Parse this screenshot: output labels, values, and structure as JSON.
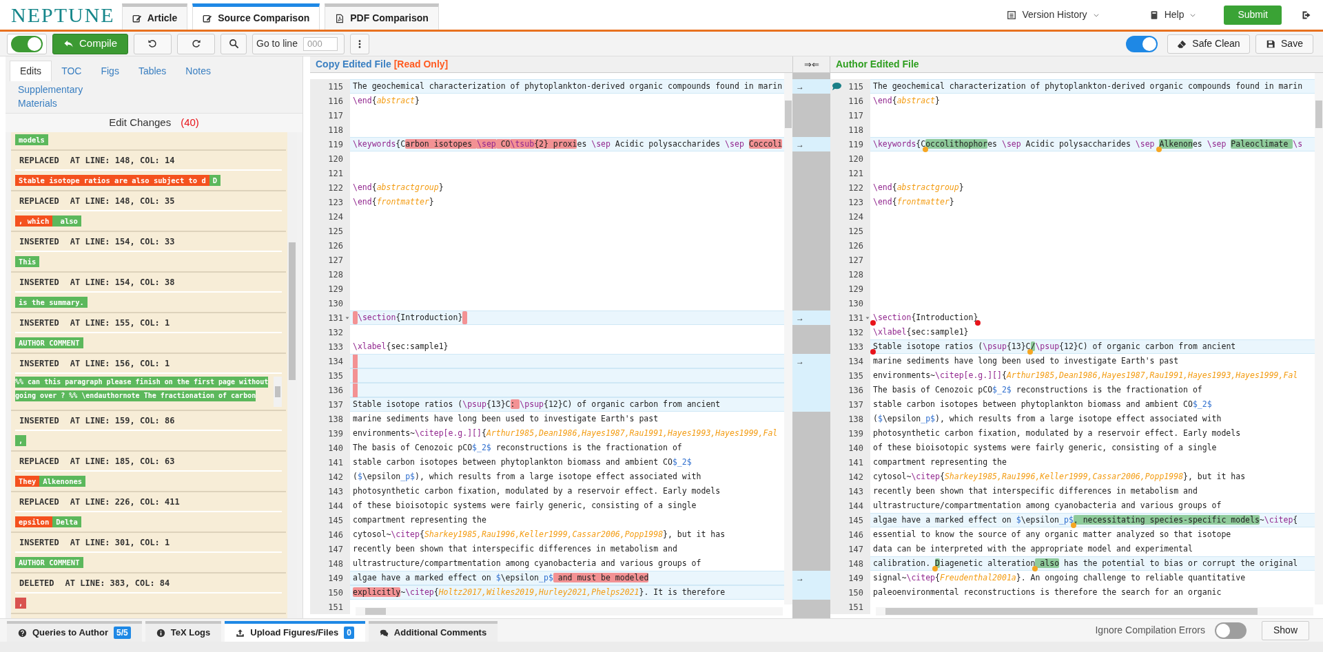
{
  "app": {
    "logo": "NEPTUNE"
  },
  "top_tabs": [
    {
      "label": "Article",
      "kind": "edit",
      "selected": false
    },
    {
      "label": "Source Comparison",
      "kind": "edit",
      "selected": true
    },
    {
      "label": "PDF Comparison",
      "kind": "pdf",
      "selected": false
    }
  ],
  "top_menu": [
    {
      "label": "Version History",
      "kind": "history"
    },
    {
      "label": "Help",
      "kind": "help"
    }
  ],
  "submit": "Submit",
  "toolbar": {
    "compile_toggle_on": true,
    "compile": "Compile",
    "goto_label": "Go to line",
    "goto_placeholder": "000",
    "safe_clean_toggle_on": true,
    "safe_clean": "Safe Clean",
    "save": "Save"
  },
  "side_tabs": [
    {
      "label": "Edits",
      "selected": true
    },
    {
      "label": "TOC",
      "selected": false
    },
    {
      "label": "Figs",
      "selected": false
    },
    {
      "label": "Tables",
      "selected": false
    },
    {
      "label": "Notes",
      "selected": false
    },
    {
      "label": "Supplementary Materials",
      "selected": false
    }
  ],
  "edit_changes": {
    "title": "Edit Changes",
    "count": "(40)",
    "items": [
      {
        "chips": [
          {
            "kind": "new",
            "text": "models"
          }
        ]
      },
      {
        "type": "REPLACED",
        "position": "AT LINE: 148, COL: 14",
        "chips": [
          {
            "kind": "old",
            "text": "Stable isotope ratios are also subject to d"
          },
          {
            "kind": "new",
            "text": "D"
          }
        ]
      },
      {
        "type": "REPLACED",
        "position": "AT LINE: 148, COL: 35",
        "chips": [
          {
            "kind": "old",
            "text": ", which"
          },
          {
            "kind": "new",
            "text": " also"
          }
        ]
      },
      {
        "type": "INSERTED",
        "position": "AT LINE: 154, COL: 33",
        "chips": [
          {
            "kind": "new",
            "text": "This"
          }
        ]
      },
      {
        "type": "INSERTED",
        "position": "AT LINE: 154, COL: 38",
        "chips": [
          {
            "kind": "new",
            "text": "is the summary."
          }
        ]
      },
      {
        "type": "INSERTED",
        "position": "AT LINE: 155, COL: 1",
        "chips": [
          {
            "kind": "new",
            "text": "AUTHOR COMMENT"
          }
        ]
      },
      {
        "type": "INSERTED",
        "position": "AT LINE: 156, COL: 1",
        "lines": [
          "%% can this paragraph please finish on the first page without",
          "going over ? %% \\endauthornote The fractionation of carbon"
        ]
      },
      {
        "type": "INSERTED",
        "position": "AT LINE: 159, COL: 86",
        "chips": [
          {
            "kind": "new",
            "text": ","
          }
        ]
      },
      {
        "type": "REPLACED",
        "position": "AT LINE: 185, COL: 63",
        "chips": [
          {
            "kind": "old",
            "text": "They"
          },
          {
            "kind": "new",
            "text": "Alkenones"
          }
        ]
      },
      {
        "type": "REPLACED",
        "position": "AT LINE: 226, COL: 411",
        "chips": [
          {
            "kind": "old",
            "text": "epsilon"
          },
          {
            "kind": "new",
            "text": "Delta"
          }
        ]
      },
      {
        "type": "INSERTED",
        "position": "AT LINE: 301, COL: 1",
        "chips": [
          {
            "kind": "new",
            "text": "AUTHOR COMMENT"
          }
        ]
      },
      {
        "type": "DELETED",
        "position": "AT LINE: 383, COL: 84",
        "chips": [
          {
            "kind": "deleted",
            "text": ","
          }
        ]
      }
    ]
  },
  "sync_button": "⇒⇐",
  "copy_pane": {
    "title": "Copy Edited File",
    "note": "[Read Only]",
    "lines": [
      {
        "n": "115",
        "changed": true,
        "merge": "→",
        "segments": [
          {
            "text": "The geochemical characterization of phytoplankton-derived organic compounds found in marin",
            "kind": "p"
          }
        ]
      },
      {
        "n": "116",
        "changed": false,
        "segments": [
          {
            "text": "\\end",
            "kind": "c"
          },
          {
            "text": "{",
            "kind": "p"
          },
          {
            "text": "abstract",
            "kind": "a"
          },
          {
            "text": "}",
            "kind": "p"
          }
        ]
      },
      {
        "n": "117",
        "changed": false
      },
      {
        "n": "118",
        "changed": false
      },
      {
        "n": "119",
        "changed": true,
        "merge": "→",
        "segments": [
          {
            "text": "\\keywords",
            "kind": "c"
          },
          {
            "text": "{C",
            "kind": "p"
          },
          {
            "text": "arbon isotopes ",
            "kind": "h"
          },
          {
            "text": "\\sep",
            "kind": "hc"
          },
          {
            "text": " CO",
            "kind": "h"
          },
          {
            "text": "\\tsub",
            "kind": "hc"
          },
          {
            "text": "{2} proxi",
            "kind": "h"
          },
          {
            "text": "es ",
            "kind": "p"
          },
          {
            "text": "\\sep",
            "kind": "c"
          },
          {
            "text": " Acidic polysaccharides ",
            "kind": "p"
          },
          {
            "text": "\\sep ",
            "kind": "c"
          },
          {
            "text": "Coccoli",
            "kind": "h"
          }
        ]
      },
      {
        "n": "120",
        "changed": false
      },
      {
        "n": "121",
        "changed": false
      },
      {
        "n": "122",
        "changed": false,
        "segments": [
          {
            "text": "\\end",
            "kind": "c"
          },
          {
            "text": "{",
            "kind": "p"
          },
          {
            "text": "abstractgroup",
            "kind": "a"
          },
          {
            "text": "}",
            "kind": "p"
          }
        ]
      },
      {
        "n": "123",
        "changed": false,
        "segments": [
          {
            "text": "\\end",
            "kind": "c"
          },
          {
            "text": "{",
            "kind": "p"
          },
          {
            "text": "frontmatter",
            "kind": "a"
          },
          {
            "text": "}",
            "kind": "p"
          }
        ]
      },
      {
        "n": "124",
        "changed": false
      },
      {
        "n": "125",
        "changed": false
      },
      {
        "n": "126",
        "changed": false
      },
      {
        "n": "127",
        "changed": false
      },
      {
        "n": "128",
        "changed": false
      },
      {
        "n": "129",
        "changed": false
      },
      {
        "n": "130",
        "changed": false
      },
      {
        "n": "131",
        "changed": true,
        "fold": true,
        "merge": "→",
        "segments": [
          {
            "kind": "gap"
          },
          {
            "text": "\\section",
            "kind": "c"
          },
          {
            "text": "{Introduction}",
            "kind": "p"
          },
          {
            "kind": "gap"
          }
        ]
      },
      {
        "n": "132",
        "changed": false
      },
      {
        "n": "133",
        "changed": false,
        "segments": [
          {
            "text": "\\xlabel",
            "kind": "c"
          },
          {
            "text": "{sec:sample1}",
            "kind": "p"
          }
        ]
      },
      {
        "n": "134",
        "changed": true,
        "merge": "→",
        "segments": [
          {
            "kind": "gap"
          }
        ]
      },
      {
        "n": "135",
        "changed": true,
        "segments": [
          {
            "kind": "gap"
          }
        ]
      },
      {
        "n": "136",
        "changed": true,
        "segments": [
          {
            "kind": "gap"
          }
        ]
      },
      {
        "n": "137",
        "changed": true,
        "segments": [
          {
            "text": "Stable isotope ratios (",
            "kind": "p"
          },
          {
            "text": "\\psup",
            "kind": "c"
          },
          {
            "text": "{13}C",
            "kind": "p"
          },
          {
            "text": ": ",
            "kind": "h"
          },
          {
            "text": "\\psup",
            "kind": "c"
          },
          {
            "text": "{12}C) of organic carbon from ancient",
            "kind": "p"
          }
        ]
      },
      {
        "n": "138",
        "changed": false,
        "segments": [
          {
            "text": "marine sediments have long been used to investigate Earth's past",
            "kind": "p"
          }
        ]
      },
      {
        "n": "139",
        "changed": false,
        "segments": [
          {
            "text": "environments~",
            "kind": "p"
          },
          {
            "text": "\\citep[e.g.][]",
            "kind": "c"
          },
          {
            "text": "{",
            "kind": "p"
          },
          {
            "text": "Arthur1985,Dean1986,Hayes1987,Rau1991,Hayes1993,Hayes1999,Fal",
            "kind": "a"
          }
        ]
      },
      {
        "n": "140",
        "changed": false,
        "segments": [
          {
            "text": "The basis of Cenozoic pCO",
            "kind": "p"
          },
          {
            "text": "$_2$",
            "kind": "m"
          },
          {
            "text": " reconstructions is the fractionation of",
            "kind": "p"
          }
        ]
      },
      {
        "n": "141",
        "changed": false,
        "segments": [
          {
            "text": "stable carbon isotopes between phytoplankton biomass and ambient CO",
            "kind": "p"
          },
          {
            "text": "$_2$",
            "kind": "m"
          }
        ]
      },
      {
        "n": "142",
        "changed": false,
        "segments": [
          {
            "text": "(",
            "kind": "p"
          },
          {
            "text": "$",
            "kind": "m"
          },
          {
            "text": "\\epsilon",
            "kind": "p"
          },
          {
            "text": "_p$",
            "kind": "m"
          },
          {
            "text": "), which results from a large isotope effect associated with",
            "kind": "p"
          }
        ]
      },
      {
        "n": "143",
        "changed": false,
        "segments": [
          {
            "text": "photosynthetic carbon fixation, modulated by a reservoir effect. Early models",
            "kind": "p"
          }
        ]
      },
      {
        "n": "144",
        "changed": false,
        "segments": [
          {
            "text": "of these bioisotopic systems were fairly generic, consisting of a single",
            "kind": "p"
          }
        ]
      },
      {
        "n": "145",
        "changed": false,
        "segments": [
          {
            "text": "compartment representing the",
            "kind": "p"
          }
        ]
      },
      {
        "n": "146",
        "changed": false,
        "segments": [
          {
            "text": "cytosol~",
            "kind": "p"
          },
          {
            "text": "\\citep",
            "kind": "c"
          },
          {
            "text": "{",
            "kind": "p"
          },
          {
            "text": "Sharkey1985,Rau1996,Keller1999,Cassar2006,Popp1998",
            "kind": "a"
          },
          {
            "text": "}, but it has",
            "kind": "p"
          }
        ]
      },
      {
        "n": "147",
        "changed": false,
        "segments": [
          {
            "text": "recently been shown that interspecific differences in metabolism and",
            "kind": "p"
          }
        ]
      },
      {
        "n": "148",
        "changed": false,
        "segments": [
          {
            "text": "ultrastructure/compartmentation among cyanobacteria and various groups of",
            "kind": "p"
          }
        ]
      },
      {
        "n": "149",
        "changed": true,
        "merge": "→",
        "segments": [
          {
            "text": "algae have a marked effect on ",
            "kind": "p"
          },
          {
            "text": "$",
            "kind": "m"
          },
          {
            "text": "\\epsilon",
            "kind": "p"
          },
          {
            "text": "_p$",
            "kind": "m"
          },
          {
            "text": " and must be modeled",
            "kind": "h"
          }
        ]
      },
      {
        "n": "150",
        "changed": true,
        "segments": [
          {
            "text": "explicitly",
            "kind": "h"
          },
          {
            "text": "~",
            "kind": "p"
          },
          {
            "text": "\\citep",
            "kind": "c"
          },
          {
            "text": "{",
            "kind": "p"
          },
          {
            "text": "Holtz2017,Wilkes2019,Hurley2021,Phelps2021",
            "kind": "a"
          },
          {
            "text": "}. It is therefore",
            "kind": "p"
          }
        ]
      },
      {
        "n": "151",
        "changed": false
      }
    ]
  },
  "author_pane": {
    "title": "Author Edited File",
    "lines": [
      {
        "n": "115",
        "changed": true,
        "comment": true,
        "segments": [
          {
            "text": "The geochemical characterization of phytoplankton-derived organic compounds found in marin",
            "kind": "p"
          }
        ]
      },
      {
        "n": "116",
        "changed": false,
        "segments": [
          {
            "text": "\\end",
            "kind": "c"
          },
          {
            "text": "{",
            "kind": "p"
          },
          {
            "text": "abstract",
            "kind": "a"
          },
          {
            "text": "}",
            "kind": "p"
          }
        ]
      },
      {
        "n": "117",
        "changed": false
      },
      {
        "n": "118",
        "changed": false
      },
      {
        "n": "119",
        "changed": true,
        "segments": [
          {
            "text": "\\keywords",
            "kind": "c"
          },
          {
            "text": "{C",
            "kind": "p"
          },
          {
            "kind": "dot",
            "color": "#f5a623"
          },
          {
            "text": "occolithophor",
            "kind": "h"
          },
          {
            "text": "es ",
            "kind": "p"
          },
          {
            "text": "\\sep",
            "kind": "c"
          },
          {
            "text": " Acidic polysaccharides ",
            "kind": "p"
          },
          {
            "text": "\\sep ",
            "kind": "c"
          },
          {
            "kind": "dot",
            "color": "#f5a623"
          },
          {
            "text": "Alkenon",
            "kind": "h"
          },
          {
            "text": "es ",
            "kind": "p"
          },
          {
            "text": "\\sep ",
            "kind": "c"
          },
          {
            "text": "Paleoclimate ",
            "kind": "h"
          },
          {
            "text": "\\s",
            "kind": "c"
          }
        ]
      },
      {
        "n": "120",
        "changed": false
      },
      {
        "n": "121",
        "changed": false
      },
      {
        "n": "122",
        "changed": false,
        "segments": [
          {
            "text": "\\end",
            "kind": "c"
          },
          {
            "text": "{",
            "kind": "p"
          },
          {
            "text": "abstractgroup",
            "kind": "a"
          },
          {
            "text": "}",
            "kind": "p"
          }
        ]
      },
      {
        "n": "123",
        "changed": false,
        "segments": [
          {
            "text": "\\end",
            "kind": "c"
          },
          {
            "text": "{",
            "kind": "p"
          },
          {
            "text": "frontmatter",
            "kind": "a"
          },
          {
            "text": "}",
            "kind": "p"
          }
        ]
      },
      {
        "n": "124",
        "changed": false
      },
      {
        "n": "125",
        "changed": false
      },
      {
        "n": "126",
        "changed": false
      },
      {
        "n": "127",
        "changed": false
      },
      {
        "n": "128",
        "changed": false
      },
      {
        "n": "129",
        "changed": false
      },
      {
        "n": "130",
        "changed": false
      },
      {
        "n": "131",
        "changed": false,
        "fold": true,
        "segments": [
          {
            "kind": "dot",
            "color": "#e8141b"
          },
          {
            "text": "\\section",
            "kind": "c"
          },
          {
            "text": "{Introduction}",
            "kind": "p"
          },
          {
            "kind": "dot",
            "color": "#e8141b"
          }
        ]
      },
      {
        "n": "132",
        "changed": false,
        "segments": [
          {
            "text": "\\xlabel",
            "kind": "c"
          },
          {
            "text": "{sec:sample1}",
            "kind": "p"
          }
        ]
      },
      {
        "n": "133",
        "changed": true,
        "segments": [
          {
            "kind": "dot",
            "color": "#e8141b"
          },
          {
            "text": "Stable isotope ratios (",
            "kind": "p"
          },
          {
            "text": "\\psup",
            "kind": "c"
          },
          {
            "text": "{13}C",
            "kind": "p"
          },
          {
            "kind": "dot",
            "color": "#f5a623"
          },
          {
            "text": "/",
            "kind": "h"
          },
          {
            "text": "\\psup",
            "kind": "c"
          },
          {
            "text": "{12}C) of organic carbon from ancient",
            "kind": "p"
          }
        ]
      },
      {
        "n": "134",
        "changed": false,
        "segments": [
          {
            "text": "marine sediments have long been used to investigate Earth's past",
            "kind": "p"
          }
        ]
      },
      {
        "n": "135",
        "changed": false,
        "segments": [
          {
            "text": "environments~",
            "kind": "p"
          },
          {
            "text": "\\citep[e.g.][]",
            "kind": "c"
          },
          {
            "text": "{",
            "kind": "p"
          },
          {
            "text": "Arthur1985,Dean1986,Hayes1987,Rau1991,Hayes1993,Hayes1999,Fal",
            "kind": "a"
          }
        ]
      },
      {
        "n": "136",
        "changed": false,
        "segments": [
          {
            "text": "The basis of Cenozoic pCO",
            "kind": "p"
          },
          {
            "text": "$_2$",
            "kind": "m"
          },
          {
            "text": " reconstructions is the fractionation of",
            "kind": "p"
          }
        ]
      },
      {
        "n": "137",
        "changed": false,
        "segments": [
          {
            "text": "stable carbon isotopes between phytoplankton biomass and ambient CO",
            "kind": "p"
          },
          {
            "text": "$_2$",
            "kind": "m"
          }
        ]
      },
      {
        "n": "138",
        "changed": false,
        "segments": [
          {
            "text": "(",
            "kind": "p"
          },
          {
            "text": "$",
            "kind": "m"
          },
          {
            "text": "\\epsilon",
            "kind": "p"
          },
          {
            "text": "_p$",
            "kind": "m"
          },
          {
            "text": "), which results from a large isotope effect associated with",
            "kind": "p"
          }
        ]
      },
      {
        "n": "139",
        "changed": false,
        "segments": [
          {
            "text": "photosynthetic carbon fixation, modulated by a reservoir effect. Early models",
            "kind": "p"
          }
        ]
      },
      {
        "n": "140",
        "changed": false,
        "segments": [
          {
            "text": "of these bioisotopic systems were fairly generic, consisting of a single",
            "kind": "p"
          }
        ]
      },
      {
        "n": "141",
        "changed": false,
        "segments": [
          {
            "text": "compartment representing the",
            "kind": "p"
          }
        ]
      },
      {
        "n": "142",
        "changed": false,
        "segments": [
          {
            "text": "cytosol~",
            "kind": "p"
          },
          {
            "text": "\\citep",
            "kind": "c"
          },
          {
            "text": "{",
            "kind": "p"
          },
          {
            "text": "Sharkey1985,Rau1996,Keller1999,Cassar2006,Popp1998",
            "kind": "a"
          },
          {
            "text": "}, but it has",
            "kind": "p"
          }
        ]
      },
      {
        "n": "143",
        "changed": false,
        "segments": [
          {
            "text": "recently been shown that interspecific differences in metabolism and",
            "kind": "p"
          }
        ]
      },
      {
        "n": "144",
        "changed": false,
        "segments": [
          {
            "text": "ultrastructure/compartmentation among cyanobacteria and various groups of",
            "kind": "p"
          }
        ]
      },
      {
        "n": "145",
        "changed": true,
        "segments": [
          {
            "text": "algae have a marked effect on ",
            "kind": "p"
          },
          {
            "text": "$",
            "kind": "m"
          },
          {
            "text": "\\epsilon",
            "kind": "p"
          },
          {
            "text": "_p$",
            "kind": "m"
          },
          {
            "kind": "dot",
            "color": "#f5a623"
          },
          {
            "text": ", necessitating species-specific models",
            "kind": "h"
          },
          {
            "text": "~",
            "kind": "p"
          },
          {
            "text": "\\citep",
            "kind": "c"
          },
          {
            "text": "{",
            "kind": "p"
          }
        ]
      },
      {
        "n": "146",
        "changed": false,
        "segments": [
          {
            "text": "essential to know the source of any organic matter analyzed so that isotope",
            "kind": "p"
          }
        ]
      },
      {
        "n": "147",
        "changed": false,
        "segments": [
          {
            "text": "data can be interpreted with the appropriate model and experimental",
            "kind": "p"
          }
        ]
      },
      {
        "n": "148",
        "changed": true,
        "segments": [
          {
            "text": "calibration. ",
            "kind": "p"
          },
          {
            "kind": "dot",
            "color": "#f5a623"
          },
          {
            "text": "D",
            "kind": "h"
          },
          {
            "text": "iagenetic alteration",
            "kind": "p"
          },
          {
            "kind": "dot",
            "color": "#f5a623"
          },
          {
            "text": " also",
            "kind": "h"
          },
          {
            "text": " has the potential to bias or corrupt the original",
            "kind": "p"
          }
        ]
      },
      {
        "n": "149",
        "changed": false,
        "segments": [
          {
            "text": "signal~",
            "kind": "p"
          },
          {
            "text": "\\citep",
            "kind": "c"
          },
          {
            "text": "{",
            "kind": "p"
          },
          {
            "text": "Freudenthal2001a",
            "kind": "a"
          },
          {
            "text": "}. An ongoing challenge to reliable quantitative",
            "kind": "p"
          }
        ]
      },
      {
        "n": "150",
        "changed": false,
        "segments": [
          {
            "text": "paleoenvironmental reconstructions is therefore the search for an organic",
            "kind": "p"
          }
        ]
      },
      {
        "n": "151",
        "changed": false
      }
    ]
  },
  "bottom_tabs": [
    {
      "label": "Queries to Author",
      "badge": "5/5",
      "kind": "question",
      "selected": false
    },
    {
      "label": "TeX Logs",
      "kind": "info",
      "selected": false
    },
    {
      "label": "Upload Figures/Files",
      "badge": "0",
      "kind": "upload",
      "selected": true
    },
    {
      "label": "Additional Comments",
      "kind": "comments",
      "selected": false
    }
  ],
  "ignore_errors": {
    "label": "Ignore Compilation Errors",
    "on": false
  },
  "show": "Show"
}
